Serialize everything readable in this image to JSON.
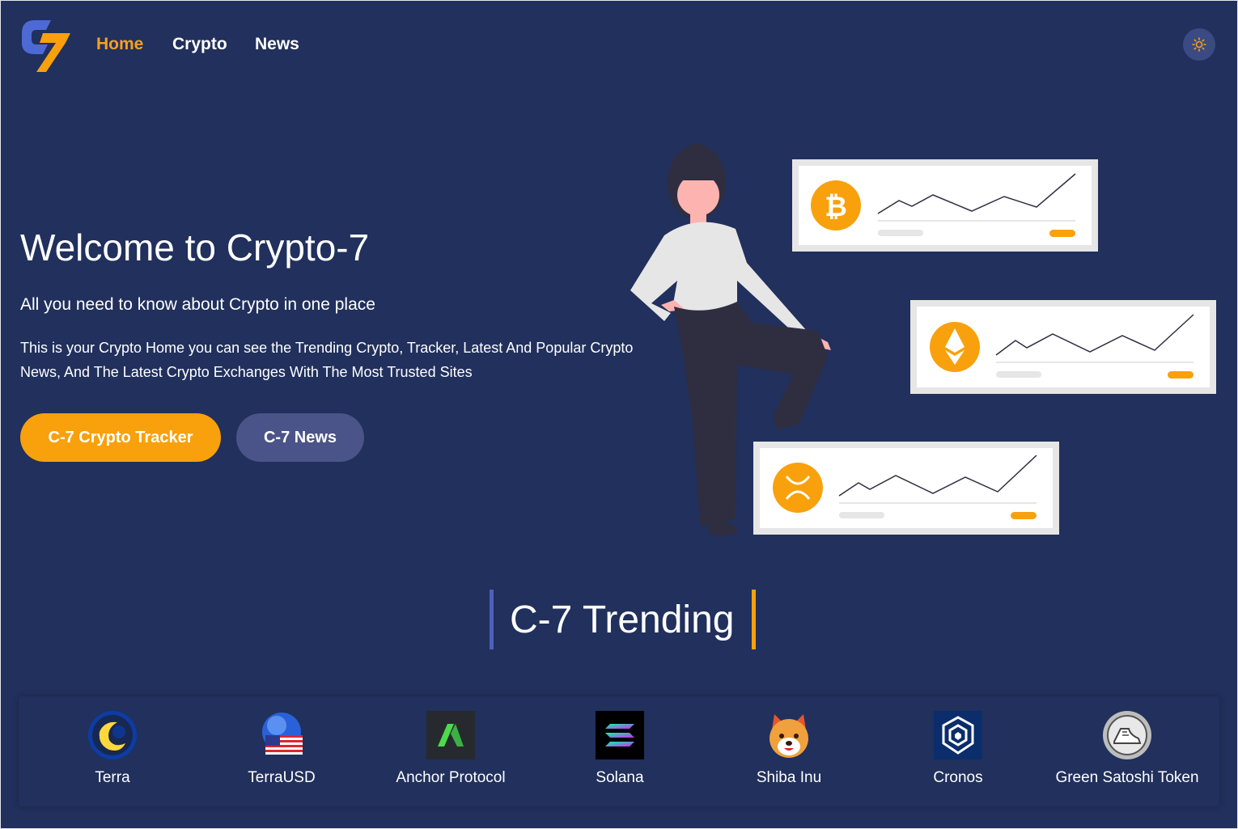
{
  "nav": {
    "home": "Home",
    "crypto": "Crypto",
    "news": "News"
  },
  "hero": {
    "title": "Welcome to Crypto-7",
    "subtitle": "All you need to know about Crypto in one place",
    "description": "This is your Crypto Home you can see the Trending Crypto, Tracker, Latest And Popular Crypto News, And The Latest Crypto Exchanges With The Most Trusted Sites",
    "tracker_button": "C-7 Crypto Tracker",
    "news_button": "C-7 News"
  },
  "trending": {
    "title": "C-7 Trending",
    "coins": [
      {
        "name": "Terra",
        "icon": "terra-icon"
      },
      {
        "name": "TerraUSD",
        "icon": "terrausd-icon"
      },
      {
        "name": "Anchor Protocol",
        "icon": "anchor-protocol-icon"
      },
      {
        "name": "Solana",
        "icon": "solana-icon"
      },
      {
        "name": "Shiba Inu",
        "icon": "shiba-inu-icon"
      },
      {
        "name": "Cronos",
        "icon": "cronos-icon"
      },
      {
        "name": "Green Satoshi Token",
        "icon": "green-satoshi-token-icon"
      }
    ]
  },
  "colors": {
    "background": "#21305c",
    "accent": "#f8a10c",
    "secondary_button": "#4a5488",
    "trending_bar_left": "#4d61b8"
  }
}
